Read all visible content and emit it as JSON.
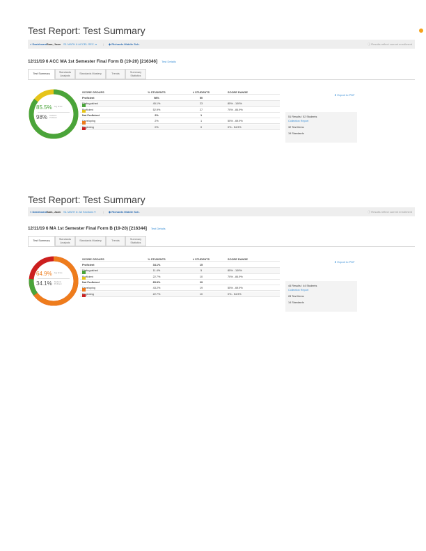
{
  "reports": [
    {
      "title": "Test Report: Test Summary",
      "toolbar": {
        "back": "< Dashboard",
        "teacher": "Sam, Joan",
        "course": "S1 MATH 6 ACCEL SEC. ▾",
        "sep": "|",
        "school": "◆ Richards Middle Sch.",
        "note": "ⓘ Results reflect current enrollment"
      },
      "test_name": "12/11/19   6 ACC MA 1st Semester Final Form B (19-20) [216346]",
      "test_details_link": "Test Details",
      "tabs": [
        "Test Summary",
        "Standards Analysis",
        "Standards Mastery",
        "Trends",
        "Summary Statistics"
      ],
      "kpi": {
        "avg_score": "85.5%",
        "avg_label": "Avg Score",
        "proficient": "98%",
        "proficient_label": "Students Proficient",
        "avg_color": "#4aa43a",
        "proficient_color": "#555555",
        "donut_fraction": 0.855,
        "donut_color": "#4aa43a",
        "donut_rest_color": "#e6c41a"
      },
      "table": {
        "headers": [
          "SCORE GROUPS",
          "% STUDENTS",
          "# STUDENTS",
          "SCORE RANGE"
        ],
        "rows": [
          {
            "label": "Proficient",
            "pct": "98%",
            "count": "50",
            "range": "",
            "group": true
          },
          {
            "label": "Distinguished",
            "pct": "45.1%",
            "count": "23",
            "range": "85% - 100%",
            "color": "#4aa43a"
          },
          {
            "label": "Proficient",
            "pct": "52.9%",
            "count": "27",
            "range": "70% - 84.9%",
            "color": "#e6c41a"
          },
          {
            "label": "Not Proficient",
            "pct": "2%",
            "count": "1",
            "range": "",
            "group": true
          },
          {
            "label": "Developing",
            "pct": "2%",
            "count": "1",
            "range": "55% - 69.9%",
            "color": "#ee7c1c"
          },
          {
            "label": "Beginning",
            "pct": "0%",
            "count": "0",
            "range": "0% - 54.9%",
            "color": "#cc1f1f"
          }
        ]
      },
      "export": "⬇ Export to PDF",
      "summary": {
        "results": "51 Results / 52 Students",
        "collection": "Collection Report",
        "items": "32 Test Items",
        "standards": "19 Standards"
      }
    },
    {
      "title": "Test Report: Test Summary",
      "toolbar": {
        "back": "< Dashboard",
        "teacher": "Sam, Joan",
        "course": "S1 MATH 6: All Sections ▾",
        "sep": "|",
        "school": "◆ Richards Middle Sch.",
        "note": "ⓘ Results reflect current enrollment"
      },
      "test_name": "12/11/19   6 MA 1st Semester Final Form B (19-20) [216344]",
      "test_details_link": "Test Details",
      "tabs": [
        "Test Summary",
        "Standards Analysis",
        "Standards Mastery",
        "Trends",
        "Summary Statistics"
      ],
      "kpi": {
        "avg_score": "64.9%",
        "avg_label": "Avg Score",
        "proficient": "34.1%",
        "proficient_label": "Students Proficient",
        "avg_color": "#ee7c1c",
        "proficient_color": "#555555",
        "donut_fraction": 0.649,
        "donut_color": "#ee7c1c",
        "donut_rest_color": "#cc1f1f",
        "donut_extra_color": "#4aa43a",
        "donut_extra_fraction": 0.114
      },
      "table": {
        "headers": [
          "SCORE GROUPS",
          "% STUDENTS",
          "# STUDENTS",
          "SCORE RANGE"
        ],
        "rows": [
          {
            "label": "Proficient",
            "pct": "34.1%",
            "count": "15",
            "range": "",
            "group": true
          },
          {
            "label": "Distinguished",
            "pct": "11.4%",
            "count": "5",
            "range": "85% - 100%",
            "color": "#4aa43a"
          },
          {
            "label": "Proficient",
            "pct": "22.7%",
            "count": "10",
            "range": "70% - 84.9%",
            "color": "#e6c41a"
          },
          {
            "label": "Not Proficient",
            "pct": "65.9%",
            "count": "29",
            "range": "",
            "group": true
          },
          {
            "label": "Developing",
            "pct": "43.2%",
            "count": "19",
            "range": "55% - 69.9%",
            "color": "#ee7c1c"
          },
          {
            "label": "Beginning",
            "pct": "22.7%",
            "count": "10",
            "range": "0% - 54.9%",
            "color": "#cc1f1f"
          }
        ]
      },
      "export": "⬇ Export to PDF",
      "summary": {
        "results": "44 Results / 44 Students",
        "collection": "Collection Report",
        "items": "28 Test Items",
        "standards": "14 Standards"
      }
    }
  ]
}
